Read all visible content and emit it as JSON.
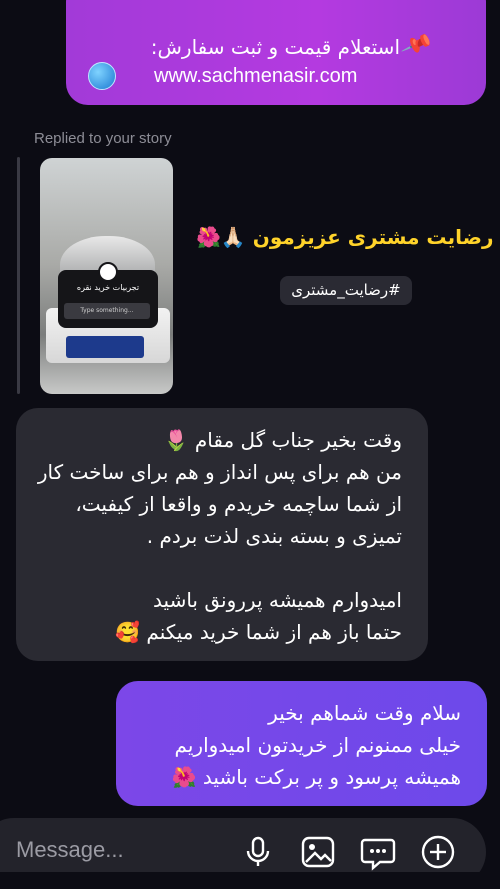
{
  "top_message": {
    "line1": "استعلام قیمت و ثبت سفارش:",
    "line2": "www.sachmenasir.com"
  },
  "story_reply": {
    "label": "Replied to your story",
    "sticker_title": "تجربیات خرید نقره",
    "sticker_input": "Type something...",
    "title": "رضایت مشتری عزیزمون",
    "title_emoji": "🙏🏻🌺",
    "hashtag": "#رضایت_مشتری"
  },
  "incoming_message": {
    "text": "وقت بخیر جناب گل مقام 🌷\nمن هم برای پس انداز و هم برای ساخت کار از شما ساچمه خریدم و واقعا از کیفیت، تمیزی و بسته بندی لذت بردم .\n\nامیدوارم همیشه پررونق باشید\nحتما باز هم از شما خرید میکنم 🥰"
  },
  "outgoing_message": {
    "text": "سلام وقت شماهم بخیر\nخیلی ممنونم از خریدتون امیدواریم همیشه پرسود و پر برکت باشید 🌺"
  },
  "composer": {
    "placeholder": "Message...",
    "icons": [
      "microphone-icon",
      "image-icon",
      "sticker-icon",
      "plus-icon"
    ]
  },
  "colors": {
    "background": "#0c0c14",
    "outgoing_gradient": [
      "#a23ad8",
      "#7c47e8"
    ],
    "incoming_bubble": "#2a2a32",
    "title_yellow": "#ffd32a"
  }
}
